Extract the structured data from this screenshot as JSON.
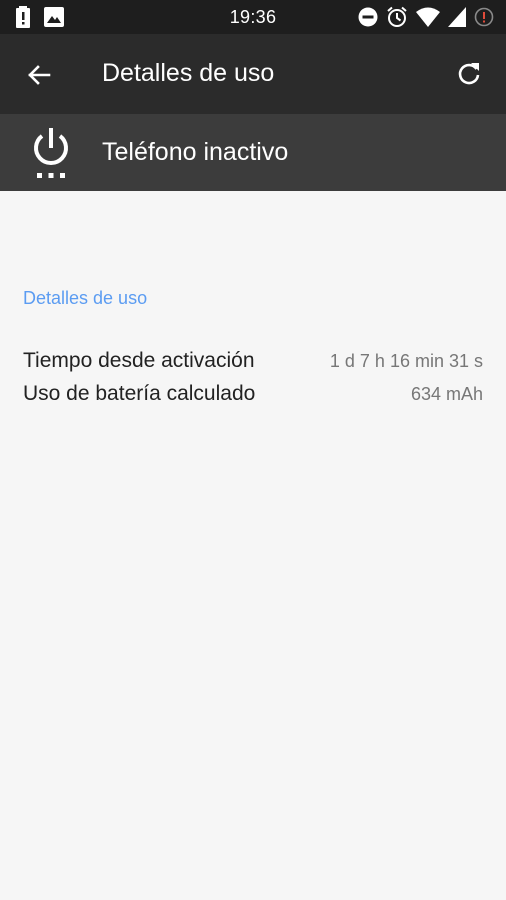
{
  "status_bar": {
    "time": "19:36",
    "icons_left": [
      "battery-alert-icon",
      "image-icon"
    ],
    "icons_right": [
      "do-not-disturb-icon",
      "alarm-icon",
      "wifi-icon",
      "signal-icon",
      "alert-circle-icon"
    ]
  },
  "app_bar": {
    "title": "Detalles de uso",
    "back_icon": "arrow-back-icon",
    "refresh_icon": "refresh-icon"
  },
  "header": {
    "title": "Teléfono inactivo",
    "icon": "power-standby-icon"
  },
  "details": {
    "section_title": "Detalles de uso",
    "rows": [
      {
        "label": "Tiempo desde activación",
        "value": "1 d 7 h 16 min 31 s"
      },
      {
        "label": "Uso de batería calculado",
        "value": "634 mAh"
      }
    ]
  },
  "colors": {
    "status_bar": "#1e1e1e",
    "app_bar": "#2b2b2b",
    "header": "#3c3c3c",
    "accent": "#5b9cf2",
    "background": "#f6f6f6"
  }
}
